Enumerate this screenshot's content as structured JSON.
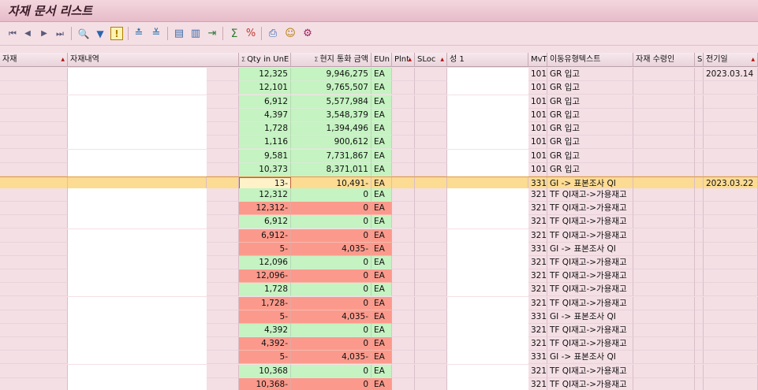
{
  "window": {
    "title": "자재 문서 리스트"
  },
  "toolbar": {
    "icons": [
      {
        "name": "first-page-icon",
        "glyph": "⏮"
      },
      {
        "name": "previous-page-icon",
        "glyph": "◀"
      },
      {
        "name": "next-page-icon",
        "glyph": "▶"
      },
      {
        "name": "last-page-icon",
        "glyph": "⏭"
      },
      {
        "name": "find-icon",
        "glyph": "🔍"
      },
      {
        "name": "filter-icon",
        "glyph": "▼"
      },
      {
        "name": "info-icon",
        "glyph": "!"
      },
      {
        "name": "sort-ascending-icon",
        "glyph": "≛"
      },
      {
        "name": "sort-descending-icon",
        "glyph": "≚"
      },
      {
        "name": "layout-icon",
        "glyph": "▤"
      },
      {
        "name": "columns-icon",
        "glyph": "▥"
      },
      {
        "name": "export-icon",
        "glyph": "⇥"
      },
      {
        "name": "sum-icon",
        "glyph": "Σ"
      },
      {
        "name": "subtotal-icon",
        "glyph": "%"
      },
      {
        "name": "print-icon",
        "glyph": "⎙"
      },
      {
        "name": "details-icon",
        "glyph": "☺"
      },
      {
        "name": "settings-icon",
        "glyph": "⚙"
      }
    ]
  },
  "table": {
    "columns": [
      {
        "key": "mat",
        "label": "자재",
        "sorted": true
      },
      {
        "key": "desc",
        "label": "자재내역"
      },
      {
        "key": "qty",
        "label": "Qty in UnE",
        "sigma": true
      },
      {
        "key": "amt",
        "label": "현지 통화 금액",
        "sigma": true
      },
      {
        "key": "eun",
        "label": "EUn"
      },
      {
        "key": "plnt",
        "label": "Plnt",
        "sorted": true
      },
      {
        "key": "sloc",
        "label": "SLoc",
        "sorted": true
      },
      {
        "key": "name1",
        "label": "성 1"
      },
      {
        "key": "mvt",
        "label": "MvT"
      },
      {
        "key": "mvtext",
        "label": "이동유형텍스트"
      },
      {
        "key": "recv",
        "label": "자재 수령인"
      },
      {
        "key": "s",
        "label": "S"
      },
      {
        "key": "post",
        "label": "전기일",
        "sorted": true
      }
    ],
    "rows": [
      {
        "qty": "12,325",
        "amt": "9,946,275",
        "eun": "EA",
        "mvt": "101",
        "mvtext": "GR 입고",
        "post": "2023.03.14",
        "tone": "green"
      },
      {
        "qty": "12,101",
        "amt": "9,765,507",
        "eun": "EA",
        "mvt": "101",
        "mvtext": "GR 입고",
        "post": "",
        "tone": "green"
      },
      {
        "qty": "6,912",
        "amt": "5,577,984",
        "eun": "EA",
        "mvt": "101",
        "mvtext": "GR 입고",
        "post": "",
        "tone": "green"
      },
      {
        "qty": "4,397",
        "amt": "3,548,379",
        "eun": "EA",
        "mvt": "101",
        "mvtext": "GR 입고",
        "post": "",
        "tone": "green"
      },
      {
        "qty": "1,728",
        "amt": "1,394,496",
        "eun": "EA",
        "mvt": "101",
        "mvtext": "GR 입고",
        "post": "",
        "tone": "green"
      },
      {
        "qty": "1,116",
        "amt": "900,612",
        "eun": "EA",
        "mvt": "101",
        "mvtext": "GR 입고",
        "post": "",
        "tone": "green"
      },
      {
        "qty": "9,581",
        "amt": "7,731,867",
        "eun": "EA",
        "mvt": "101",
        "mvtext": "GR 입고",
        "post": "",
        "tone": "green"
      },
      {
        "qty": "10,373",
        "amt": "8,371,011",
        "eun": "EA",
        "mvt": "101",
        "mvtext": "GR 입고",
        "post": "",
        "tone": "green"
      },
      {
        "qty": "13-",
        "amt": "10,491-",
        "eun": "EA",
        "mvt": "331",
        "mvtext": "GI -> 표본조사 QI",
        "post": "2023.03.22",
        "tone": "selected"
      },
      {
        "qty": "12,312",
        "amt": "0",
        "eun": "EA",
        "mvt": "321",
        "mvtext": "TF QI재고->가용재고",
        "post": "",
        "tone": "green"
      },
      {
        "qty": "12,312-",
        "amt": "0",
        "eun": "EA",
        "mvt": "321",
        "mvtext": "TF QI재고->가용재고",
        "post": "",
        "tone": "red"
      },
      {
        "qty": "6,912",
        "amt": "0",
        "eun": "EA",
        "mvt": "321",
        "mvtext": "TF QI재고->가용재고",
        "post": "",
        "tone": "green"
      },
      {
        "qty": "6,912-",
        "amt": "0",
        "eun": "EA",
        "mvt": "321",
        "mvtext": "TF QI재고->가용재고",
        "post": "",
        "tone": "red"
      },
      {
        "qty": "5-",
        "amt": "4,035-",
        "eun": "EA",
        "mvt": "331",
        "mvtext": "GI -> 표본조사 QI",
        "post": "",
        "tone": "red"
      },
      {
        "qty": "12,096",
        "amt": "0",
        "eun": "EA",
        "mvt": "321",
        "mvtext": "TF QI재고->가용재고",
        "post": "",
        "tone": "green"
      },
      {
        "qty": "12,096-",
        "amt": "0",
        "eun": "EA",
        "mvt": "321",
        "mvtext": "TF QI재고->가용재고",
        "post": "",
        "tone": "red"
      },
      {
        "qty": "1,728",
        "amt": "0",
        "eun": "EA",
        "mvt": "321",
        "mvtext": "TF QI재고->가용재고",
        "post": "",
        "tone": "green"
      },
      {
        "qty": "1,728-",
        "amt": "0",
        "eun": "EA",
        "mvt": "321",
        "mvtext": "TF QI재고->가용재고",
        "post": "",
        "tone": "red"
      },
      {
        "qty": "5-",
        "amt": "4,035-",
        "eun": "EA",
        "mvt": "331",
        "mvtext": "GI -> 표본조사 QI",
        "post": "",
        "tone": "red"
      },
      {
        "qty": "4,392",
        "amt": "0",
        "eun": "EA",
        "mvt": "321",
        "mvtext": "TF QI재고->가용재고",
        "post": "",
        "tone": "green"
      },
      {
        "qty": "4,392-",
        "amt": "0",
        "eun": "EA",
        "mvt": "321",
        "mvtext": "TF QI재고->가용재고",
        "post": "",
        "tone": "red"
      },
      {
        "qty": "5-",
        "amt": "4,035-",
        "eun": "EA",
        "mvt": "331",
        "mvtext": "GI -> 표본조사 QI",
        "post": "",
        "tone": "red"
      },
      {
        "qty": "10,368",
        "amt": "0",
        "eun": "EA",
        "mvt": "321",
        "mvtext": "TF QI재고->가용재고",
        "post": "",
        "tone": "green"
      },
      {
        "qty": "10,368-",
        "amt": "0",
        "eun": "EA",
        "mvt": "321",
        "mvtext": "TF QI재고->가용재고",
        "post": "",
        "tone": "red"
      }
    ]
  },
  "colors": {
    "pink": "#f4dfe5",
    "green": "#c5f3c2",
    "red": "#fb9a8c",
    "selected": "#fcdb92"
  }
}
